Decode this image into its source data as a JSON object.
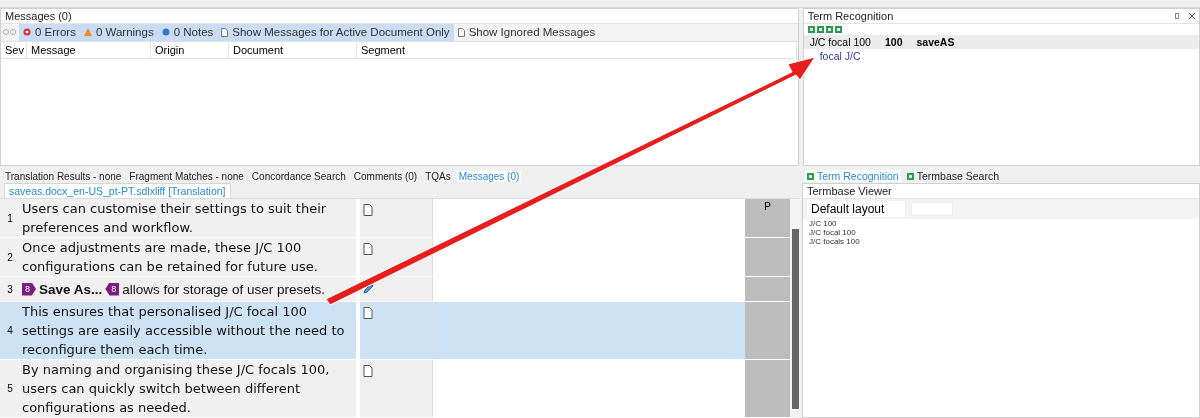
{
  "messages_panel": {
    "title": "Messages (0)",
    "toolbar": [
      {
        "kind": "error",
        "label": "0 Errors",
        "selected": true
      },
      {
        "kind": "warning",
        "label": "0 Warnings",
        "selected": true
      },
      {
        "kind": "note",
        "label": "0 Notes",
        "selected": true
      },
      {
        "kind": "toggle",
        "label": "Show Messages for Active Document Only",
        "selected": true
      },
      {
        "kind": "toggle",
        "label": "Show Ignored Messages",
        "selected": false
      }
    ],
    "columns": [
      "Sev",
      "Message",
      "Origin",
      "Document",
      "Segment"
    ]
  },
  "term_recognition": {
    "title": "Term Recognition",
    "entry": {
      "term": "J/C focal 100",
      "score": "100",
      "source": "saveAS"
    },
    "translation": "focal J/C"
  },
  "bottom_tabs": [
    {
      "label": "Translation Results - none",
      "selected": false
    },
    {
      "label": "Fragment Matches - none",
      "selected": false
    },
    {
      "label": "Concordance Search",
      "selected": false
    },
    {
      "label": "Comments (0)",
      "selected": false
    },
    {
      "label": "TQAs",
      "selected": false
    },
    {
      "label": "Messages (0)",
      "selected": true
    }
  ],
  "document_tab": "saveas.docx_en-US_pt-PT.sdlxliff [Translation]",
  "segments": [
    {
      "number": "1",
      "kind": "plain",
      "source": "Users can customise their settings to suit their preferences and workflow.",
      "draft": false,
      "selected": false,
      "marker": "P"
    },
    {
      "number": "2",
      "kind": "plain",
      "source": "Once adjustments are made, these J/C 100 configurations can be retained for future use.",
      "draft": false,
      "selected": false
    },
    {
      "number": "3",
      "kind": "tagged",
      "tag_open": "8",
      "bold": "Save As...",
      "tag_close": "8",
      "source": "allows for storage of user presets.",
      "draft": true,
      "selected": false
    },
    {
      "number": "4",
      "kind": "plain",
      "source": "This ensures that personalised J/C focal 100 settings are easily accessible without the need to reconfigure them each time.",
      "draft": false,
      "selected": true
    },
    {
      "number": "5",
      "kind": "plain",
      "source": "By naming and organising these J/C focals 100, users can quickly switch between different configurations as needed.",
      "draft": false,
      "selected": false
    }
  ],
  "right_tabs": [
    {
      "label": "Term Recognition",
      "selected": true
    },
    {
      "label": "Termbase Search",
      "selected": false
    }
  ],
  "termbase_viewer": {
    "title": "Termbase Viewer",
    "layout": "Default layout",
    "entries": [
      "J/C 100",
      "J/C focal 100",
      "J/C focals 100"
    ]
  }
}
